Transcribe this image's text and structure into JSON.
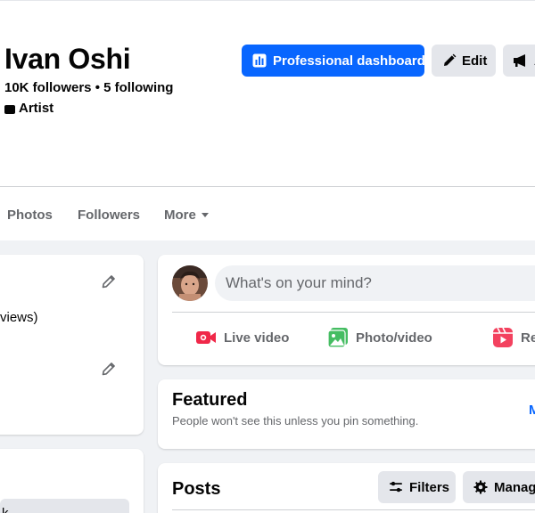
{
  "profile": {
    "name": "Ivan Oshi",
    "stats": "10K followers • 5 following",
    "category": "Artist"
  },
  "header_actions": {
    "primary_label": "Professional dashboard",
    "edit_label": "Edit",
    "advertise_label": "A"
  },
  "tabs": [
    {
      "label": "Photos"
    },
    {
      "label": "Followers"
    },
    {
      "label": "More"
    }
  ],
  "left_column": {
    "views_text": "views)",
    "second_card_item": "k"
  },
  "composer": {
    "placeholder": "What's on your mind?",
    "actions": [
      {
        "label": "Live video",
        "icon": "live-video-icon",
        "color": "#f02849"
      },
      {
        "label": "Photo/video",
        "icon": "photo-video-icon",
        "color": "#45bd62"
      },
      {
        "label": "Re",
        "icon": "reel-icon",
        "color": "#f3425f"
      }
    ]
  },
  "featured": {
    "title": "Featured",
    "subtitle": "People won't see this unless you pin something.",
    "link": "M"
  },
  "posts": {
    "title": "Posts",
    "filters_label": "Filters",
    "manage_label": "Manag"
  },
  "colors": {
    "brand": "#0866ff",
    "secondary_button": "#e4e6eb",
    "page_background": "#f0f2f5",
    "secondary_text": "#65676b"
  }
}
